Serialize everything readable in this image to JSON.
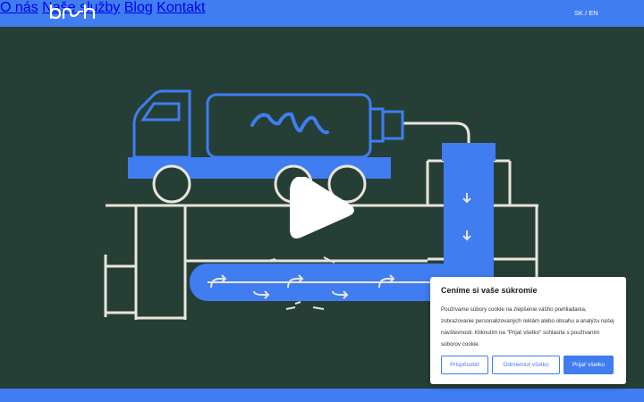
{
  "header": {
    "logo_text": "bnh",
    "nav": [
      "O nás",
      "Naše služby",
      "Blog",
      "Kontakt"
    ],
    "lang_sk": "SK",
    "lang_sep": "/",
    "lang_en": "EN"
  },
  "colors": {
    "brand_blue": "#3f7df1",
    "hero_bg": "#263f36",
    "line_white": "#e9e4dc"
  },
  "hero": {
    "play_icon": "play-icon"
  },
  "cookie": {
    "title": "Ceníme si vaše súkromie",
    "text": "Používame súbory cookie na zlepšenie vášho prehliadania, zobrazovanie personalizovaných reklám alebo obsahu a analýzu našej návštevnosti. Kliknutím na \"Prijať všetko\" súhlasíte s používaním súborov cookie.",
    "customize_label": "Prispôsobiť",
    "reject_label": "Odmietnuť všetko",
    "accept_label": "Prijať všetko"
  }
}
